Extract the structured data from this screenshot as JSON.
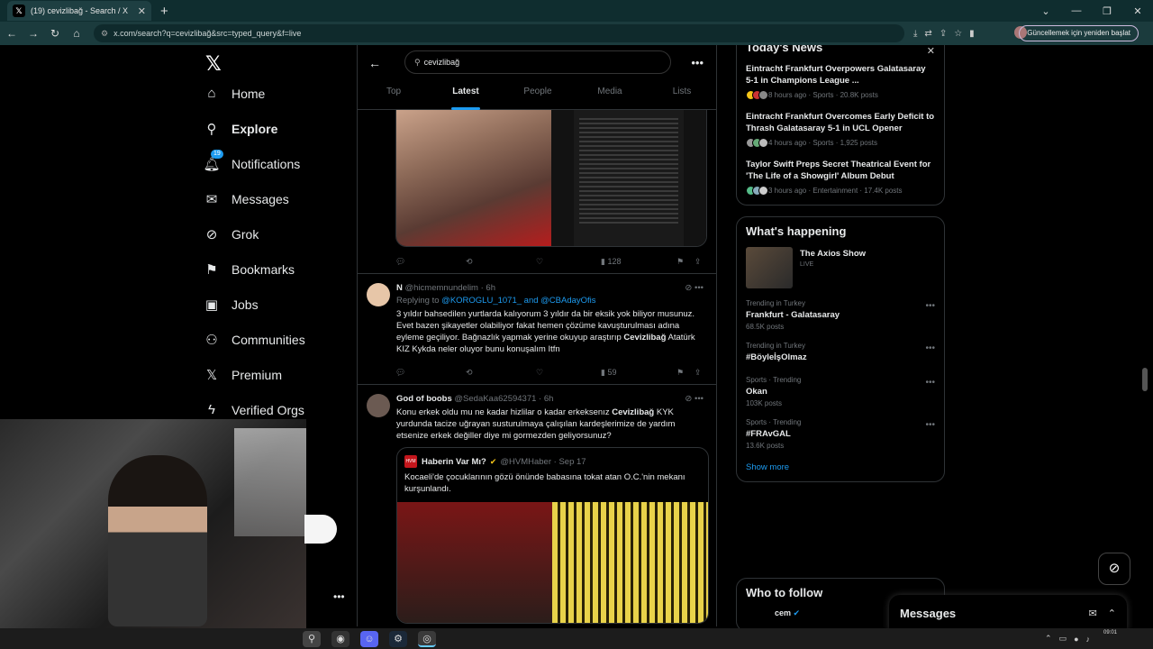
{
  "browser": {
    "tab_title": "(19) cevizlibağ - Search / X",
    "url": "x.com/search?q=cevizlibağ&src=typed_query&f=live",
    "update_button": "Güncellemek için yeniden başlat"
  },
  "nav": {
    "items": [
      {
        "label": "Home",
        "icon": "home-icon"
      },
      {
        "label": "Explore",
        "icon": "search-icon"
      },
      {
        "label": "Notifications",
        "icon": "bell-icon",
        "badge": "19"
      },
      {
        "label": "Messages",
        "icon": "mail-icon"
      },
      {
        "label": "Grok",
        "icon": "grok-icon"
      },
      {
        "label": "Bookmarks",
        "icon": "bookmark-icon"
      },
      {
        "label": "Jobs",
        "icon": "briefcase-icon"
      },
      {
        "label": "Communities",
        "icon": "people-icon"
      },
      {
        "label": "Premium",
        "icon": "x-icon"
      },
      {
        "label": "Verified Orgs",
        "icon": "bolt-icon"
      }
    ]
  },
  "search": {
    "query": "cevizlibağ",
    "tabs": [
      "Top",
      "Latest",
      "People",
      "Media",
      "Lists"
    ],
    "active_tab": "Latest"
  },
  "post0": {
    "views": "128"
  },
  "post1": {
    "name": "N",
    "handle": "@hicmemnundelim",
    "time": "6h",
    "replying_prefix": "Replying to",
    "replying_to": "@KOROGLU_1071_ and @CBAdayOfis",
    "text_a": "3 yıldır bahsedilen yurtlarda kalıyorum 3 yıldır da bir eksik yok biliyor musunuz. Evet bazen şikayetler olabiliyor fakat hemen çözüme kavuşturulması adına eyleme geçiliyor. Bağnazlık yapmak yerine okuyup araştırıp ",
    "text_bold": "Cevizlibağ",
    "text_b": " Atatürk KIZ Kykda neler oluyor bunu konuşalım Itfn",
    "views": "59"
  },
  "post2": {
    "name": "God of boobs",
    "handle": "@SedaKaa62594371",
    "time": "6h",
    "text_a": "Konu erkek oldu mu ne kadar hizlilar o kadar erkeksenız ",
    "text_bold": "Cevizlibağ",
    "text_b": " KYK yurdunda tacize uğrayan susturulmaya çalışılan kardeşlerimize de yardım etsenize erkek değiller diye mi gormezden geliyorsunuz?",
    "quote": {
      "name": "Haberin Var Mı?",
      "handle": "@HVMHaber",
      "date": "Sep 17",
      "text": "Kocaeli'de çocuklarının gözü önünde babasına tokat atan O.C.'nin mekanı kurşunlandı."
    }
  },
  "news": {
    "title": "Today's News",
    "items": [
      {
        "title": "Eintracht Frankfurt Overpowers Galatasaray 5-1 in Champions League ...",
        "meta": "8 hours ago · Sports · 20.8K posts"
      },
      {
        "title": "Eintracht Frankfurt Overcomes Early Deficit to Thrash Galatasaray 5-1 in UCL Opener",
        "meta": "4 hours ago · Sports · 1,925 posts"
      },
      {
        "title": "Taylor Swift Preps Secret Theatrical Event for 'The Life of a Showgirl' Album Debut",
        "meta": "3 hours ago · Entertainment · 17.4K posts"
      }
    ]
  },
  "happening": {
    "title": "What's happening",
    "live_name": "The Axios Show",
    "live_label": "LIVE",
    "trends": [
      {
        "context": "Trending in Turkey",
        "name": "Frankfurt - Galatasaray",
        "posts": "68.5K posts"
      },
      {
        "context": "Trending in Turkey",
        "name": "#BöyleİşOlmaz",
        "posts": ""
      },
      {
        "context": "Sports · Trending",
        "name": "Okan",
        "posts": "103K posts"
      },
      {
        "context": "Sports · Trending",
        "name": "#FRAvGAL",
        "posts": "13.6K posts"
      }
    ],
    "show_more": "Show more"
  },
  "follow": {
    "title": "Who to follow",
    "first": "cem"
  },
  "messages": {
    "title": "Messages"
  },
  "clock": "09:01"
}
